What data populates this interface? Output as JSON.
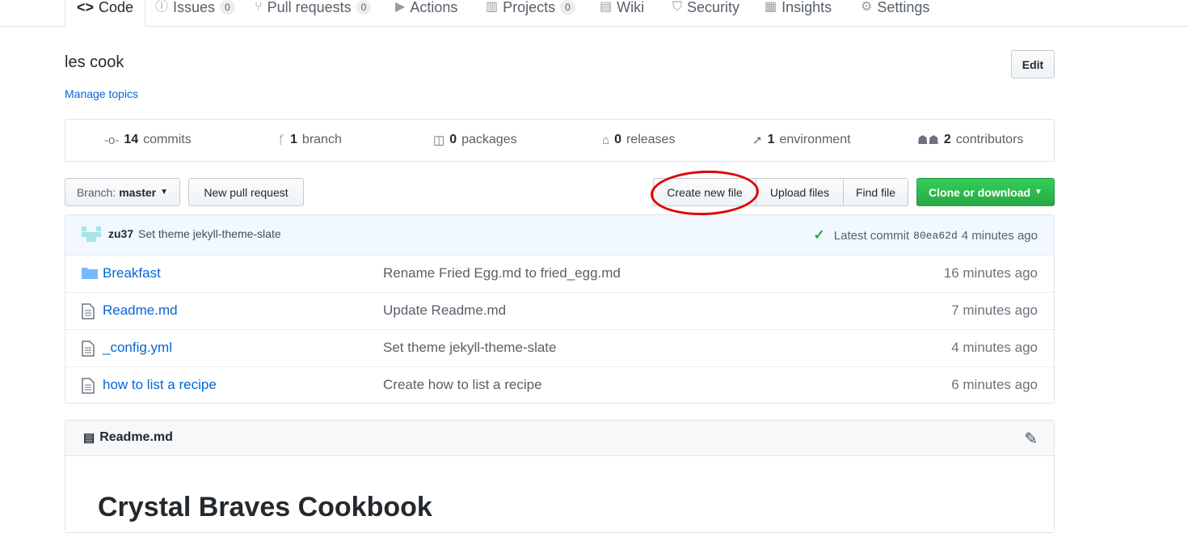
{
  "tabs": [
    {
      "label": "Code",
      "icon": "code-icon"
    },
    {
      "label": "Issues",
      "count": "0",
      "icon": "issue-icon"
    },
    {
      "label": "Pull requests",
      "count": "0",
      "icon": "pull-request-icon"
    },
    {
      "label": "Actions",
      "icon": "play-icon"
    },
    {
      "label": "Projects",
      "count": "0",
      "icon": "project-icon"
    },
    {
      "label": "Wiki",
      "icon": "book-icon"
    },
    {
      "label": "Security",
      "icon": "shield-icon"
    },
    {
      "label": "Insights",
      "icon": "graph-icon"
    },
    {
      "label": "Settings",
      "icon": "gear-icon"
    }
  ],
  "repo": {
    "description": "les cook",
    "manage_topics": "Manage topics",
    "edit_label": "Edit"
  },
  "summary": [
    {
      "num": "14",
      "label": "commits"
    },
    {
      "num": "1",
      "label": "branch"
    },
    {
      "num": "0",
      "label": "packages"
    },
    {
      "num": "0",
      "label": "releases"
    },
    {
      "num": "1",
      "label": "environment"
    },
    {
      "num": "2",
      "label": "contributors"
    }
  ],
  "file_nav": {
    "branch_prefix": "Branch:",
    "branch": "master",
    "new_pr": "New pull request",
    "create_file": "Create new file",
    "upload_files": "Upload files",
    "find_file": "Find file",
    "clone": "Clone or download"
  },
  "latest_commit": {
    "author": "zu37",
    "message": "Set theme jekyll-theme-slate",
    "prefix": "Latest commit",
    "sha": "80ea62d",
    "age": "4 minutes ago"
  },
  "files": [
    {
      "name": "Breakfast",
      "type": "folder",
      "message": "Rename Fried Egg.md to fried_egg.md",
      "age": "16 minutes ago"
    },
    {
      "name": "Readme.md",
      "type": "file",
      "message": "Update Readme.md",
      "age": "7 minutes ago"
    },
    {
      "name": "_config.yml",
      "type": "file",
      "message": "Set theme jekyll-theme-slate",
      "age": "4 minutes ago"
    },
    {
      "name": "how to list a recipe",
      "type": "file",
      "message": "Create how to list a recipe",
      "age": "6 minutes ago"
    }
  ],
  "readme": {
    "filename": "Readme.md",
    "heading": "Crystal Braves Cookbook"
  },
  "colors": {
    "accent": "#0366d6",
    "green": "#28a745",
    "annotation": "#e00000"
  }
}
